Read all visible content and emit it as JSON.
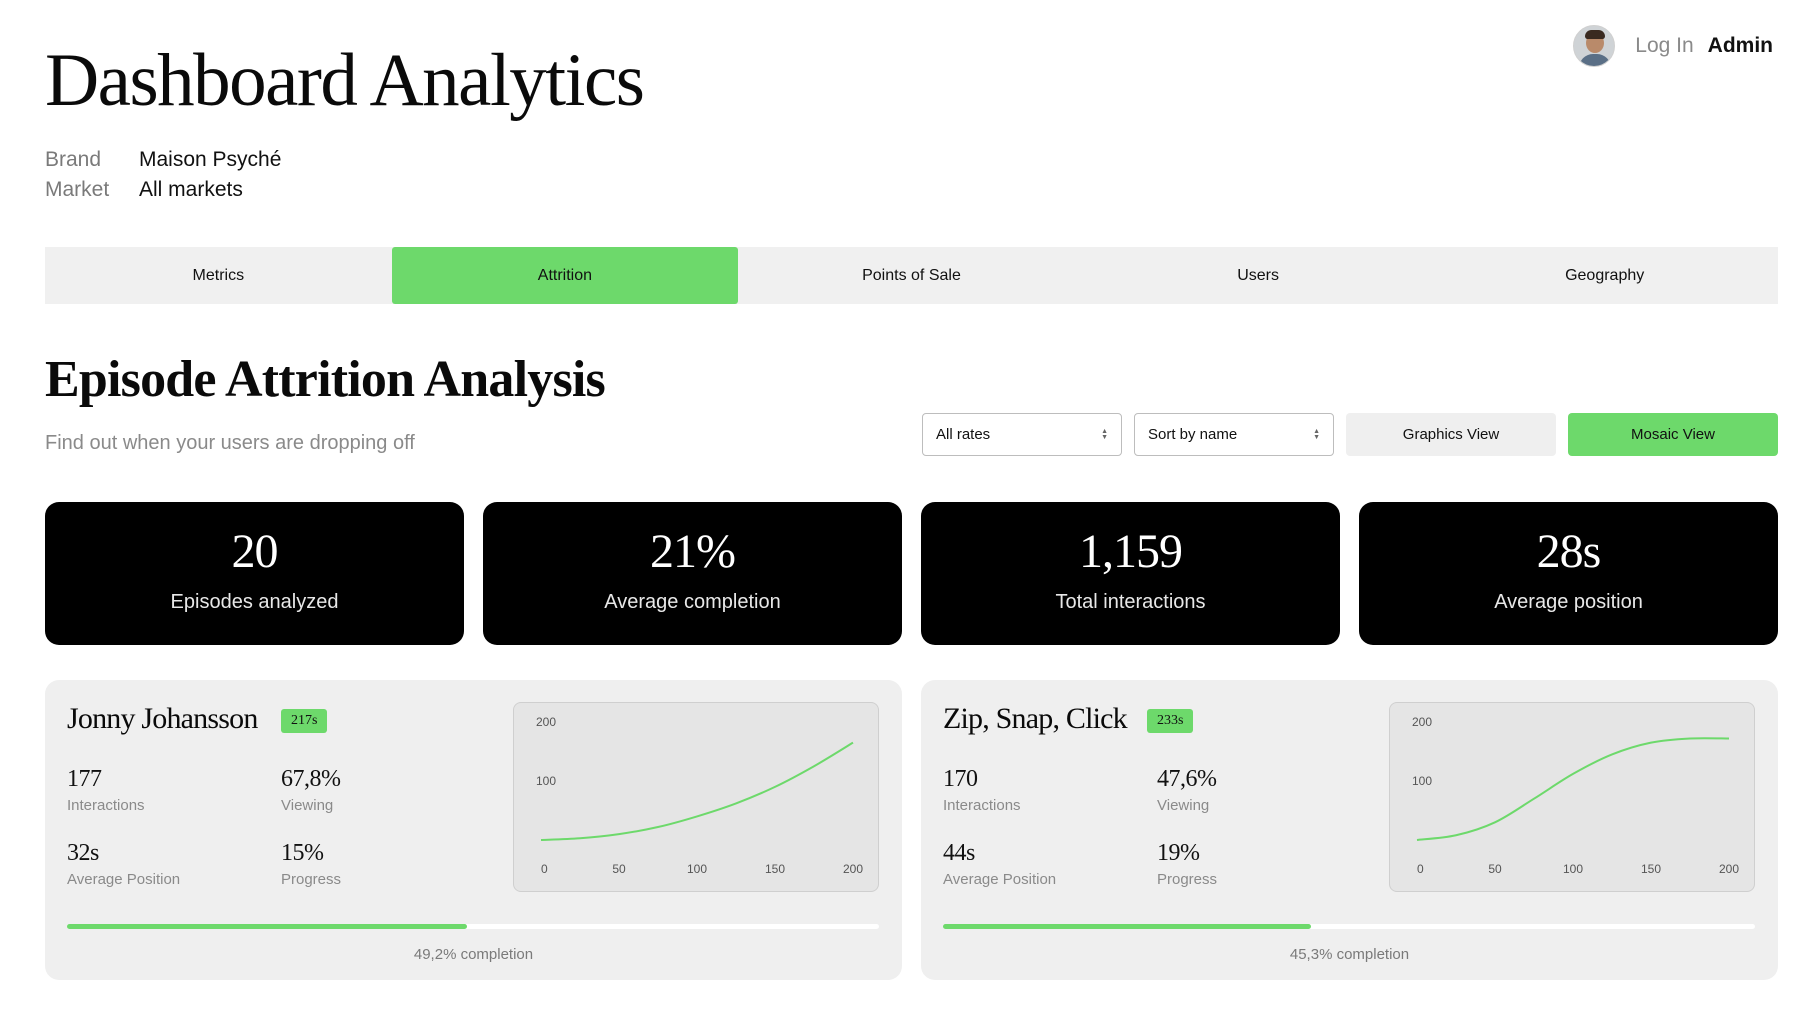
{
  "header": {
    "title": "Dashboard Analytics",
    "brand_label": "Brand",
    "brand_value": "Maison Psyché",
    "market_label": "Market",
    "market_value": "All markets",
    "login_label": "Log In",
    "user_label": "Admin"
  },
  "tabs": [
    {
      "label": "Metrics",
      "active": false
    },
    {
      "label": "Attrition",
      "active": true
    },
    {
      "label": "Points of Sale",
      "active": false
    },
    {
      "label": "Users",
      "active": false
    },
    {
      "label": "Geography",
      "active": false
    }
  ],
  "section": {
    "title": "Episode Attrition Analysis",
    "subtitle": "Find out when your users are dropping off"
  },
  "controls": {
    "rate_select": "All rates",
    "sort_select": "Sort by name",
    "graphics_view": "Graphics View",
    "mosaic_view": "Mosaic View"
  },
  "stats": [
    {
      "value": "20",
      "label": "Episodes analyzed"
    },
    {
      "value": "21%",
      "label": "Average completion"
    },
    {
      "value": "1,159",
      "label": "Total interactions"
    },
    {
      "value": "28s",
      "label": "Average position"
    }
  ],
  "episodes": [
    {
      "title": "Jonny Johansson",
      "badge": "217s",
      "interactions": "177",
      "interactions_label": "Interactions",
      "viewing": "67,8%",
      "viewing_label": "Viewing",
      "avg_position": "32s",
      "avg_position_label": "Average Position",
      "progress": "15%",
      "progress_label": "Progress",
      "completion_fraction": 0.492,
      "completion_text": "49,2% completion"
    },
    {
      "title": "Zip, Snap, Click",
      "badge": "233s",
      "interactions": "170",
      "interactions_label": "Interactions",
      "viewing": "47,6%",
      "viewing_label": "Viewing",
      "avg_position": "44s",
      "avg_position_label": "Average Position",
      "progress": "19%",
      "progress_label": "Progress",
      "completion_fraction": 0.453,
      "completion_text": "45,3% completion"
    }
  ],
  "chart_data": [
    {
      "type": "line",
      "x_ticks": [
        "0",
        "50",
        "100",
        "150",
        "200"
      ],
      "y_ticks": [
        "100",
        "200"
      ],
      "xlim": [
        0,
        200
      ],
      "ylim": [
        0,
        200
      ],
      "grid": false,
      "series": [
        {
          "x": [
            0,
            25,
            50,
            75,
            100,
            125,
            150,
            175,
            200
          ],
          "y": [
            0,
            3,
            10,
            22,
            40,
            62,
            90,
            125,
            165
          ],
          "color": "#6dd96b"
        }
      ]
    },
    {
      "type": "line",
      "x_ticks": [
        "0",
        "50",
        "100",
        "150",
        "200"
      ],
      "y_ticks": [
        "100",
        "200"
      ],
      "xlim": [
        0,
        200
      ],
      "ylim": [
        0,
        200
      ],
      "grid": false,
      "series": [
        {
          "x": [
            0,
            25,
            50,
            75,
            100,
            125,
            150,
            175,
            200
          ],
          "y": [
            0,
            8,
            30,
            70,
            112,
            145,
            165,
            172,
            172
          ],
          "color": "#6dd96b"
        }
      ]
    }
  ]
}
